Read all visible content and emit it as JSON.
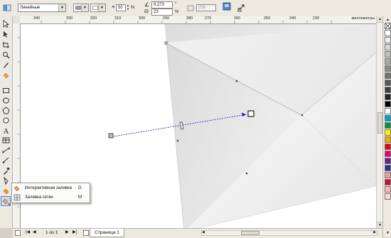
{
  "property_bar": {
    "fill_type": "Линейные",
    "angle": "50",
    "angle_unit": "%",
    "x_value": "9,273",
    "x_unit": "°",
    "y_value": "23",
    "y_unit": "%",
    "steps": "256"
  },
  "ruler": {
    "units": "миллиметры",
    "ticks": [
      "340",
      "330",
      "320",
      "310",
      "300",
      "290",
      "280",
      "270",
      "260",
      "250",
      "240",
      "230"
    ]
  },
  "flyout": {
    "items": [
      {
        "label": "Интерактивная заливка",
        "shortcut": "G"
      },
      {
        "label": "Заливка сетки",
        "shortcut": "M"
      }
    ]
  },
  "status_bar": {
    "page_counter": "1 из 1",
    "page_tab": "Страница 1"
  },
  "palette_colors": [
    "#ffffff",
    "#f2f2f2",
    "#d9d9d9",
    "#bfbfbf",
    "#a6a6a6",
    "#8c8c8c",
    "#737373",
    "#595959",
    "#404040",
    "#262626",
    "#000000",
    "#ffffff",
    "#00a0e0",
    "#009640",
    "#fff200",
    "#f7a600",
    "#e30613",
    "#e6007e",
    "#662483",
    "#2e3192",
    "#f39c9c",
    "#c8102e",
    "#f5b7b1",
    "#ffd8c8"
  ],
  "tools": [
    "pick-icon",
    "shape-icon",
    "crop-icon",
    "zoom-icon",
    "freehand-icon",
    "smart-fill-icon",
    "rectangle-icon",
    "ellipse-icon",
    "polygon-icon",
    "text-icon",
    "table-icon",
    "dimension-icon",
    "connector-icon",
    "blend-icon",
    "eyedropper-icon",
    "outline-icon",
    "fill-icon",
    "interactive-fill-icon"
  ]
}
